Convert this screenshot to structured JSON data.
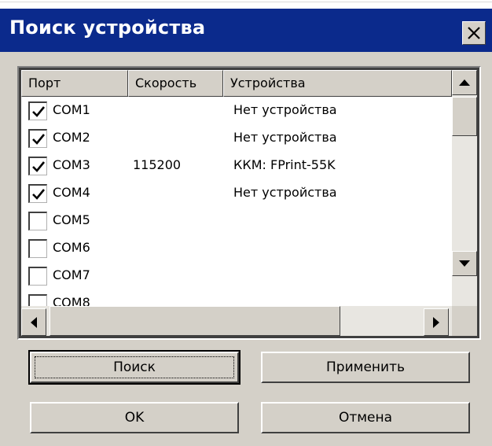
{
  "dialog": {
    "title": "Поиск устройства"
  },
  "table": {
    "columns": [
      "Порт",
      "Скорость",
      "Устройства"
    ],
    "rows": [
      {
        "port": "COM1",
        "checked": true,
        "speed": "",
        "device": "Нет устройства"
      },
      {
        "port": "COM2",
        "checked": true,
        "speed": "",
        "device": "Нет устройства"
      },
      {
        "port": "COM3",
        "checked": true,
        "speed": "115200",
        "device": "ККМ: FPrint-55K"
      },
      {
        "port": "COM4",
        "checked": true,
        "speed": "",
        "device": "Нет устройства"
      },
      {
        "port": "COM5",
        "checked": false,
        "speed": "",
        "device": ""
      },
      {
        "port": "COM6",
        "checked": false,
        "speed": "",
        "device": ""
      },
      {
        "port": "COM7",
        "checked": false,
        "speed": "",
        "device": ""
      },
      {
        "port": "COM8",
        "checked": false,
        "speed": "",
        "device": ""
      }
    ]
  },
  "buttons": {
    "search": "Поиск",
    "apply": "Применить",
    "ok": "OK",
    "cancel": "Отмена"
  },
  "icons": {
    "close": "close-icon",
    "scroll_up": "arrow-up-icon",
    "scroll_down": "arrow-down-icon",
    "scroll_left": "arrow-left-icon",
    "scroll_right": "arrow-right-icon",
    "check": "checkmark-icon"
  },
  "colors": {
    "titlebar": "#0b2a8c",
    "face": "#d4d0c8",
    "header_text": "#000000"
  }
}
